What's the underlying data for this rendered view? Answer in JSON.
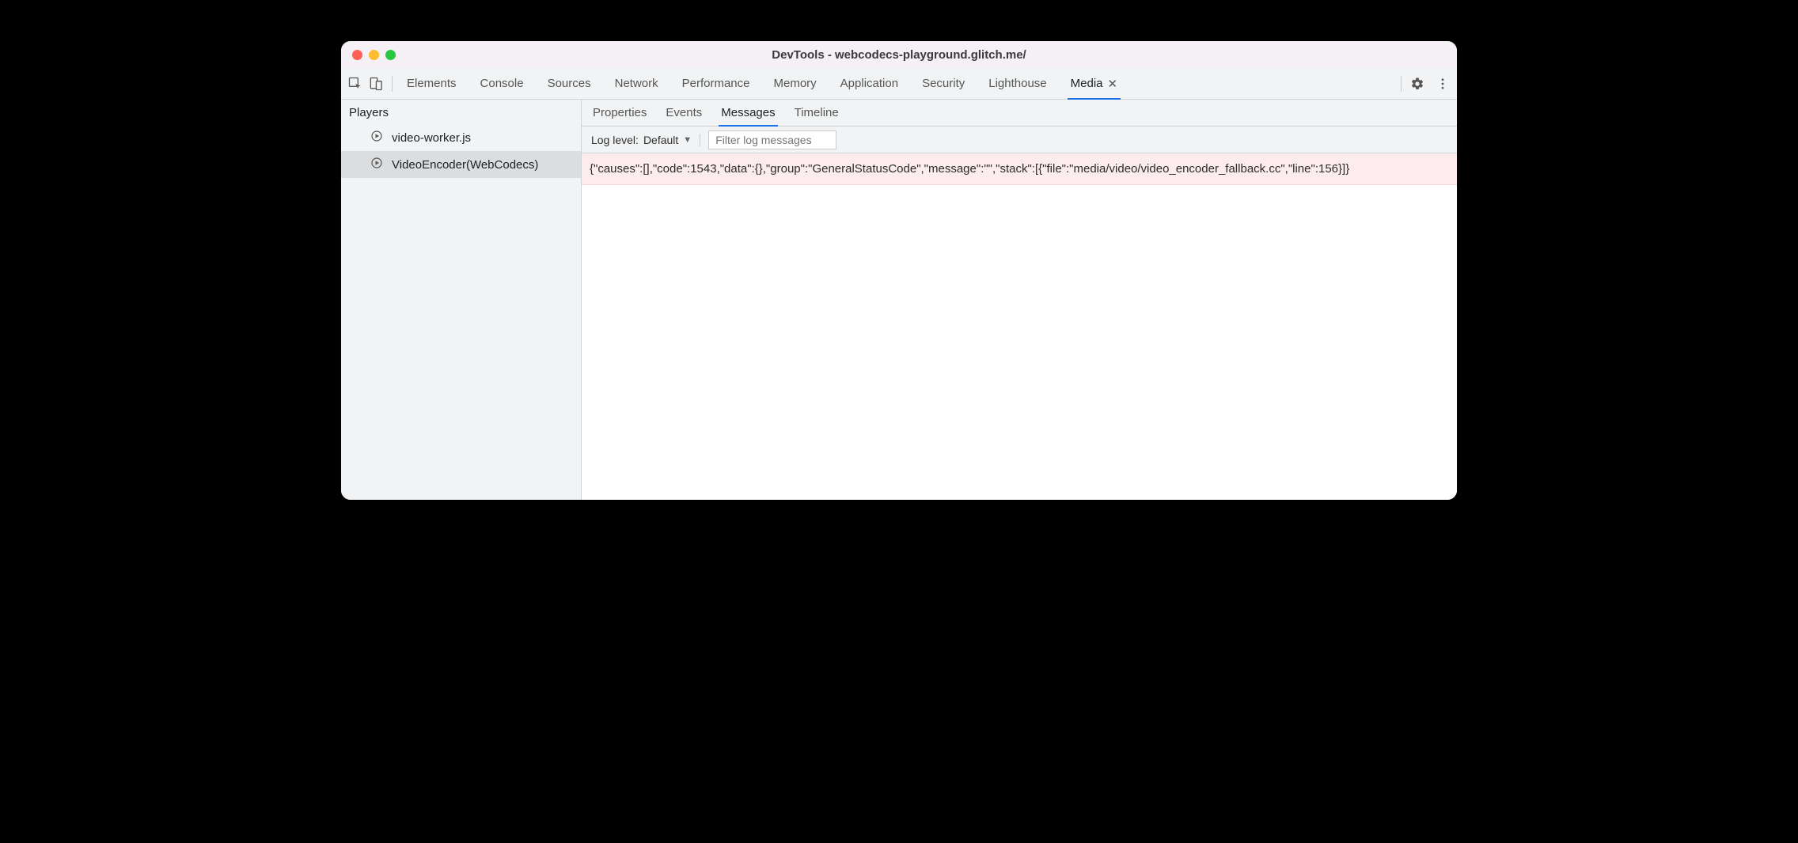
{
  "window": {
    "title": "DevTools - webcodecs-playground.glitch.me/"
  },
  "toolbar": {
    "tabs": [
      {
        "label": "Elements",
        "active": false
      },
      {
        "label": "Console",
        "active": false
      },
      {
        "label": "Sources",
        "active": false
      },
      {
        "label": "Network",
        "active": false
      },
      {
        "label": "Performance",
        "active": false
      },
      {
        "label": "Memory",
        "active": false
      },
      {
        "label": "Application",
        "active": false
      },
      {
        "label": "Security",
        "active": false
      },
      {
        "label": "Lighthouse",
        "active": false
      },
      {
        "label": "Media",
        "active": true,
        "closable": true
      }
    ]
  },
  "sidebar": {
    "heading": "Players",
    "items": [
      {
        "label": "video-worker.js",
        "selected": false
      },
      {
        "label": "VideoEncoder(WebCodecs)",
        "selected": true
      }
    ]
  },
  "subpanel": {
    "tabs": [
      {
        "label": "Properties",
        "active": false
      },
      {
        "label": "Events",
        "active": false
      },
      {
        "label": "Messages",
        "active": true
      },
      {
        "label": "Timeline",
        "active": false
      }
    ],
    "log_level_label": "Log level:",
    "log_level_value": "Default",
    "filter_placeholder": "Filter log messages"
  },
  "messages": [
    {
      "level": "error",
      "text": "{\"causes\":[],\"code\":1543,\"data\":{},\"group\":\"GeneralStatusCode\",\"message\":\"\",\"stack\":[{\"file\":\"media/video/video_encoder_fallback.cc\",\"line\":156}]}"
    }
  ]
}
